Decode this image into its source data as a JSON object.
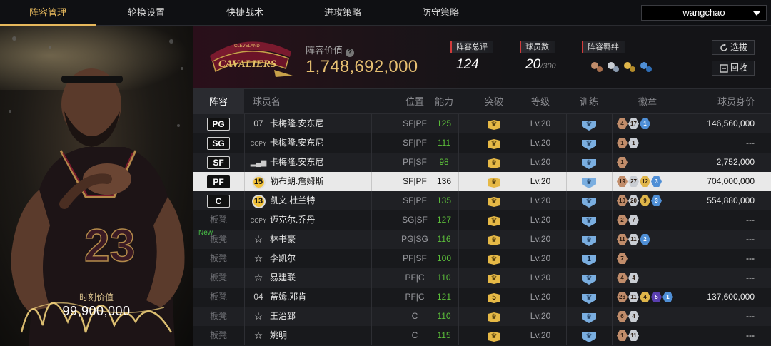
{
  "nav": {
    "tabs": [
      {
        "label": "阵容管理",
        "active": true
      },
      {
        "label": "轮换设置",
        "active": false
      },
      {
        "label": "快捷战术",
        "active": false
      },
      {
        "label": "进攻策略",
        "active": false
      },
      {
        "label": "防守策略",
        "active": false
      }
    ],
    "user": "wangchao"
  },
  "player_card": {
    "value_label": "时刻价值",
    "value": "99,900,000",
    "jersey_number": "23"
  },
  "team": {
    "logo_text": "CAVALIERS",
    "logo_subtext": "CLEVELAND",
    "value_label": "阵容价值",
    "value": "1,748,692,000",
    "rating_label": "阵容总评",
    "rating": "124",
    "count_label": "球员数",
    "count": "20",
    "count_max": "/300",
    "bond_label": "阵容羁绊",
    "actions": {
      "pick": "选拔",
      "recycle": "回收"
    }
  },
  "table": {
    "headers": {
      "slot": "阵容",
      "name": "球员名",
      "position": "位置",
      "ability": "能力",
      "breakthrough": "突破",
      "level": "等级",
      "training": "训练",
      "badges": "徽章",
      "worth": "球员身价"
    },
    "rows": [
      {
        "slot": "PG",
        "starter": true,
        "new": "",
        "jersey": "07",
        "jtype": "text",
        "name": "卡梅隆.安东尼",
        "position": "SF|PF",
        "ability": "125",
        "brk": "",
        "level": "Lv.20",
        "train": "",
        "badges": [
          {
            "c": "bronze",
            "t": "4"
          },
          {
            "c": "silver",
            "t": "17"
          },
          {
            "c": "blue",
            "t": "1"
          }
        ],
        "worth": "146,560,000"
      },
      {
        "slot": "SG",
        "starter": true,
        "new": "",
        "jersey": "COPY",
        "jtype": "copy",
        "name": "卡梅隆.安东尼",
        "position": "SF|PF",
        "ability": "111",
        "brk": "",
        "level": "Lv.20",
        "train": "",
        "badges": [
          {
            "c": "bronze",
            "t": "1"
          },
          {
            "c": "silver",
            "t": "1"
          }
        ],
        "worth": "---"
      },
      {
        "slot": "SF",
        "starter": true,
        "new": "",
        "jersey": "bars",
        "jtype": "bars",
        "name": "卡梅隆.安东尼",
        "position": "PF|SF",
        "ability": "98",
        "brk": "",
        "level": "Lv.20",
        "train": "",
        "badges": [
          {
            "c": "bronze",
            "t": "1"
          }
        ],
        "worth": "2,752,000"
      },
      {
        "slot": "PF",
        "starter": true,
        "new": "",
        "jersey": "15",
        "jtype": "circle",
        "name": "勒布朗.詹姆斯",
        "position": "SF|PF",
        "ability": "136",
        "brk": "",
        "level": "Lv.20",
        "train": "",
        "badges": [
          {
            "c": "bronze",
            "t": "19"
          },
          {
            "c": "silver",
            "t": "27"
          },
          {
            "c": "gold",
            "t": "12"
          },
          {
            "c": "blue",
            "t": "3"
          }
        ],
        "worth": "704,000,000",
        "selected": true
      },
      {
        "slot": "C",
        "starter": true,
        "new": "",
        "jersey": "13",
        "jtype": "circle",
        "name": "凯文.杜兰特",
        "position": "SF|PF",
        "ability": "135",
        "brk": "",
        "level": "Lv.20",
        "train": "",
        "badges": [
          {
            "c": "bronze",
            "t": "10"
          },
          {
            "c": "silver",
            "t": "20"
          },
          {
            "c": "gold",
            "t": "9"
          },
          {
            "c": "blue",
            "t": "3"
          }
        ],
        "worth": "554,880,000"
      },
      {
        "slot": "板凳",
        "starter": false,
        "new": "",
        "jersey": "COPY",
        "jtype": "copy",
        "name": "迈克尔.乔丹",
        "position": "SG|SF",
        "ability": "127",
        "brk": "",
        "level": "Lv.20",
        "train": "",
        "badges": [
          {
            "c": "bronze",
            "t": "2"
          },
          {
            "c": "silver",
            "t": "7"
          }
        ],
        "worth": "---"
      },
      {
        "slot": "板凳",
        "starter": false,
        "new": "New",
        "jersey": "star",
        "jtype": "star",
        "name": "林书豪",
        "position": "PG|SG",
        "ability": "116",
        "brk": "",
        "level": "Lv.20",
        "train": "",
        "badges": [
          {
            "c": "bronze",
            "t": "11"
          },
          {
            "c": "silver",
            "t": "11"
          },
          {
            "c": "blue",
            "t": "2"
          }
        ],
        "worth": "---"
      },
      {
        "slot": "板凳",
        "starter": false,
        "new": "",
        "jersey": "star",
        "jtype": "star",
        "name": "李凯尔",
        "position": "PF|SF",
        "ability": "100",
        "brk": "",
        "level": "Lv.20",
        "train": "1",
        "badges": [
          {
            "c": "bronze",
            "t": "7"
          }
        ],
        "worth": "---"
      },
      {
        "slot": "板凳",
        "starter": false,
        "new": "",
        "jersey": "star",
        "jtype": "star",
        "name": "易建联",
        "position": "PF|C",
        "ability": "110",
        "brk": "",
        "level": "Lv.20",
        "train": "",
        "badges": [
          {
            "c": "bronze",
            "t": "4"
          },
          {
            "c": "silver",
            "t": "4"
          }
        ],
        "worth": "---"
      },
      {
        "slot": "板凳",
        "starter": false,
        "new": "",
        "jersey": "04",
        "jtype": "text",
        "name": "蒂姆.邓肯",
        "position": "PF|C",
        "ability": "121",
        "brk": "5",
        "level": "Lv.20",
        "train": "",
        "badges": [
          {
            "c": "bronze",
            "t": "26"
          },
          {
            "c": "silver",
            "t": "11"
          },
          {
            "c": "gold",
            "t": "4"
          },
          {
            "c": "purple",
            "t": "5"
          },
          {
            "c": "blue",
            "t": "1"
          }
        ],
        "worth": "137,600,000"
      },
      {
        "slot": "板凳",
        "starter": false,
        "new": "",
        "jersey": "star",
        "jtype": "star",
        "name": "王治郅",
        "position": "C",
        "ability": "110",
        "brk": "",
        "level": "Lv.20",
        "train": "",
        "badges": [
          {
            "c": "bronze",
            "t": "6"
          },
          {
            "c": "silver",
            "t": "4"
          }
        ],
        "worth": "---"
      },
      {
        "slot": "板凳",
        "starter": false,
        "new": "",
        "jersey": "star",
        "jtype": "star",
        "name": "姚明",
        "position": "C",
        "ability": "115",
        "brk": "",
        "level": "Lv.20",
        "train": "",
        "badges": [
          {
            "c": "bronze",
            "t": "1"
          },
          {
            "c": "silver",
            "t": "11"
          }
        ],
        "worth": "---"
      }
    ]
  },
  "colors": {
    "accent_gold": "#e6b85c",
    "ability_green": "#5cbf3a",
    "selected_row": "#e9e9e9",
    "red_tag": "#d23b3b"
  }
}
